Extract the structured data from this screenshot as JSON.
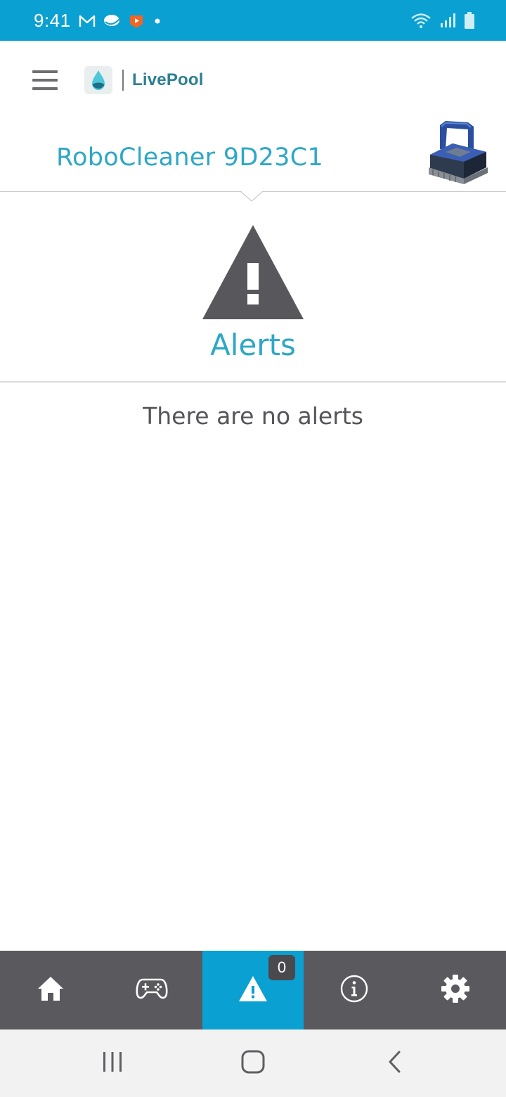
{
  "status_bar": {
    "time": "9:41",
    "background": "#0aa0d2",
    "left_icons": [
      "gmail-icon",
      "chat-bubble-icon",
      "video-app-icon",
      "notification-dot-icon"
    ],
    "right_icons": [
      "wifi-icon",
      "signal-icon",
      "battery-icon"
    ]
  },
  "header": {
    "menu_icon": "hamburger-menu-icon",
    "logo_text": "LivePool"
  },
  "device": {
    "name": "RoboCleaner 9D23C1"
  },
  "alerts": {
    "title": "Alerts",
    "empty_message": "There are no alerts"
  },
  "tab_bar": {
    "active_index": 2,
    "tabs": [
      {
        "icon": "home-icon"
      },
      {
        "icon": "gamepad-icon"
      },
      {
        "icon": "warning-icon",
        "badge": "0"
      },
      {
        "icon": "info-icon"
      },
      {
        "icon": "gear-icon"
      }
    ]
  },
  "colors": {
    "accent": "#0aa0d2",
    "title_text": "#2ea7c6",
    "tab_bar": "#5a5a5e",
    "warning_icon": "#58585c"
  }
}
